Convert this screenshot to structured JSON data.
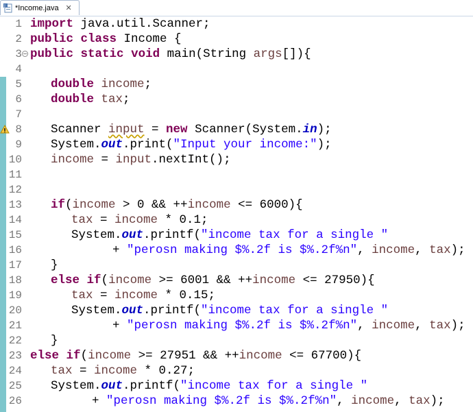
{
  "tab": {
    "label": "*Income.java",
    "close_glyph": "✕",
    "icon": "java-file-icon"
  },
  "colors": {
    "keyword": "#7f0055",
    "string": "#2a00ff",
    "variable": "#6a3e3e",
    "static_field": "#0000c0",
    "line_number": "#787878",
    "overview_ruler": "#7ec6cc"
  },
  "lines": [
    {
      "num": "1",
      "indent": 0,
      "tokens": [
        {
          "t": "import",
          "c": "kw"
        },
        {
          "t": " java.util.Scanner;"
        }
      ]
    },
    {
      "num": "2",
      "indent": 0,
      "tokens": [
        {
          "t": "public",
          "c": "kw"
        },
        {
          "t": " "
        },
        {
          "t": "class",
          "c": "kw"
        },
        {
          "t": " Income {"
        }
      ]
    },
    {
      "num": "3",
      "indent": 0,
      "fold": true,
      "tokens": [
        {
          "t": "public",
          "c": "kw"
        },
        {
          "t": " "
        },
        {
          "t": "static",
          "c": "kw"
        },
        {
          "t": " "
        },
        {
          "t": "void",
          "c": "kw"
        },
        {
          "t": " main(String "
        },
        {
          "t": "args",
          "c": "fld"
        },
        {
          "t": "[]){"
        }
      ]
    },
    {
      "num": "4",
      "indent": 0,
      "tokens": []
    },
    {
      "num": "5",
      "indent": 4,
      "tokens": [
        {
          "t": "double",
          "c": "kw"
        },
        {
          "t": " "
        },
        {
          "t": "income",
          "c": "fld"
        },
        {
          "t": ";"
        }
      ]
    },
    {
      "num": "6",
      "indent": 4,
      "tokens": [
        {
          "t": "double",
          "c": "kw"
        },
        {
          "t": " "
        },
        {
          "t": "tax",
          "c": "fld"
        },
        {
          "t": ";"
        }
      ]
    },
    {
      "num": "7",
      "indent": 0,
      "tokens": []
    },
    {
      "num": "8",
      "indent": 4,
      "warning": true,
      "tokens": [
        {
          "t": "Scanner "
        },
        {
          "t": "input",
          "c": "fld sq"
        },
        {
          "t": " = "
        },
        {
          "t": "new",
          "c": "kw"
        },
        {
          "t": " Scanner(System."
        },
        {
          "t": "in",
          "c": "st"
        },
        {
          "t": ");"
        }
      ]
    },
    {
      "num": "9",
      "indent": 4,
      "tokens": [
        {
          "t": "System."
        },
        {
          "t": "out",
          "c": "st"
        },
        {
          "t": ".print("
        },
        {
          "t": "\"Input your income:\"",
          "c": "str"
        },
        {
          "t": ");"
        }
      ]
    },
    {
      "num": "10",
      "indent": 4,
      "tokens": [
        {
          "t": "income",
          "c": "fld"
        },
        {
          "t": " = "
        },
        {
          "t": "input",
          "c": "fld"
        },
        {
          "t": ".nextInt();"
        }
      ]
    },
    {
      "num": "11",
      "indent": 0,
      "tokens": []
    },
    {
      "num": "12",
      "indent": 0,
      "tokens": []
    },
    {
      "num": "13",
      "indent": 4,
      "tokens": [
        {
          "t": "if",
          "c": "kw"
        },
        {
          "t": "("
        },
        {
          "t": "income",
          "c": "fld"
        },
        {
          "t": " > 0 && ++"
        },
        {
          "t": "income",
          "c": "fld"
        },
        {
          "t": " <= 6000){"
        }
      ]
    },
    {
      "num": "14",
      "indent": 8,
      "tokens": [
        {
          "t": "tax",
          "c": "fld"
        },
        {
          "t": " = "
        },
        {
          "t": "income",
          "c": "fld"
        },
        {
          "t": " * 0.1;"
        }
      ]
    },
    {
      "num": "15",
      "indent": 8,
      "tokens": [
        {
          "t": "System."
        },
        {
          "t": "out",
          "c": "st"
        },
        {
          "t": ".printf("
        },
        {
          "t": "\"income tax for a single \"",
          "c": "str"
        }
      ]
    },
    {
      "num": "16",
      "indent": 16,
      "tokens": [
        {
          "t": "+ "
        },
        {
          "t": "\"perosn making $%.2f is $%.2f%n\"",
          "c": "str"
        },
        {
          "t": ", "
        },
        {
          "t": "income",
          "c": "fld"
        },
        {
          "t": ", "
        },
        {
          "t": "tax",
          "c": "fld"
        },
        {
          "t": ");"
        }
      ]
    },
    {
      "num": "17",
      "indent": 4,
      "tokens": [
        {
          "t": "}"
        }
      ]
    },
    {
      "num": "18",
      "indent": 4,
      "tokens": [
        {
          "t": "else",
          "c": "kw"
        },
        {
          "t": " "
        },
        {
          "t": "if",
          "c": "kw"
        },
        {
          "t": "("
        },
        {
          "t": "income",
          "c": "fld"
        },
        {
          "t": " >= 6001 && ++"
        },
        {
          "t": "income",
          "c": "fld"
        },
        {
          "t": " <= 27950){"
        }
      ]
    },
    {
      "num": "19",
      "indent": 8,
      "tokens": [
        {
          "t": "tax",
          "c": "fld"
        },
        {
          "t": " = "
        },
        {
          "t": "income",
          "c": "fld"
        },
        {
          "t": " * 0.15;"
        }
      ]
    },
    {
      "num": "20",
      "indent": 8,
      "tokens": [
        {
          "t": "System."
        },
        {
          "t": "out",
          "c": "st"
        },
        {
          "t": ".printf("
        },
        {
          "t": "\"income tax for a single \"",
          "c": "str"
        }
      ]
    },
    {
      "num": "21",
      "indent": 16,
      "tokens": [
        {
          "t": "+ "
        },
        {
          "t": "\"perosn making $%.2f is $%.2f%n\"",
          "c": "str"
        },
        {
          "t": ", "
        },
        {
          "t": "income",
          "c": "fld"
        },
        {
          "t": ", "
        },
        {
          "t": "tax",
          "c": "fld"
        },
        {
          "t": ");"
        }
      ]
    },
    {
      "num": "22",
      "indent": 4,
      "tokens": [
        {
          "t": "}"
        }
      ]
    },
    {
      "num": "23",
      "indent": 0,
      "tokens": [
        {
          "t": "else",
          "c": "kw"
        },
        {
          "t": " "
        },
        {
          "t": "if",
          "c": "kw"
        },
        {
          "t": "("
        },
        {
          "t": "income",
          "c": "fld"
        },
        {
          "t": " >= 27951 && ++"
        },
        {
          "t": "income",
          "c": "fld"
        },
        {
          "t": " <= 67700){"
        }
      ]
    },
    {
      "num": "24",
      "indent": 4,
      "tokens": [
        {
          "t": "tax",
          "c": "fld"
        },
        {
          "t": " = "
        },
        {
          "t": "income",
          "c": "fld"
        },
        {
          "t": " * 0.27;"
        }
      ]
    },
    {
      "num": "25",
      "indent": 4,
      "tokens": [
        {
          "t": "System."
        },
        {
          "t": "out",
          "c": "st"
        },
        {
          "t": ".printf("
        },
        {
          "t": "\"income tax for a single \"",
          "c": "str"
        }
      ]
    },
    {
      "num": "26",
      "indent": 12,
      "tokens": [
        {
          "t": "+ "
        },
        {
          "t": "\"perosn making $%.2f is $%.2f%n\"",
          "c": "str"
        },
        {
          "t": ", "
        },
        {
          "t": "income",
          "c": "fld"
        },
        {
          "t": ", "
        },
        {
          "t": "tax",
          "c": "fld"
        },
        {
          "t": ");"
        }
      ]
    }
  ]
}
